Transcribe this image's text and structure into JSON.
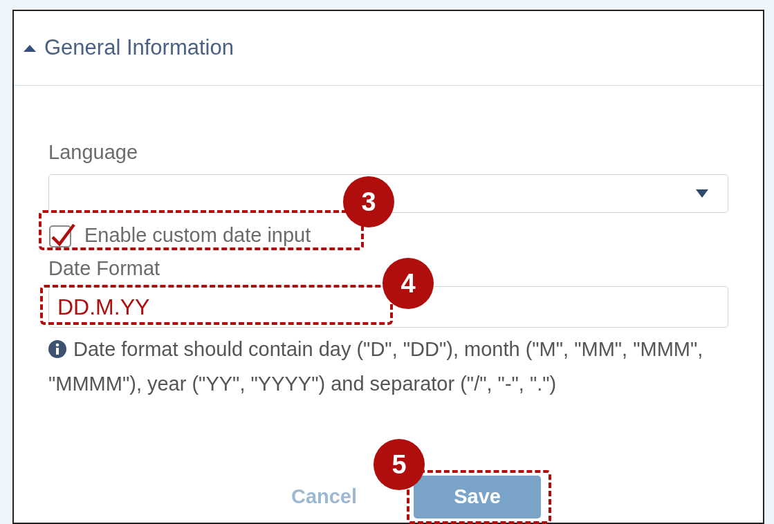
{
  "section": {
    "title": "General Information",
    "expanded": true
  },
  "language": {
    "label": "Language"
  },
  "custom_date": {
    "label": "Enable custom date input",
    "checked": true
  },
  "date_format": {
    "label": "Date Format",
    "value": "DD.M.YY",
    "help": "Date format should contain day (\"D\", \"DD\"), month (\"M\", \"MM\", \"MMM\", \"MMMM\"), year (\"YY\", \"YYYY\") and separator (\"/\", \"-\", \".\")"
  },
  "buttons": [
    {
      "kind": "cancel",
      "label": "Cancel"
    },
    {
      "kind": "save",
      "label": "Save"
    }
  ],
  "annotations": [
    {
      "number": "3"
    },
    {
      "number": "4"
    },
    {
      "number": "5"
    }
  ]
}
